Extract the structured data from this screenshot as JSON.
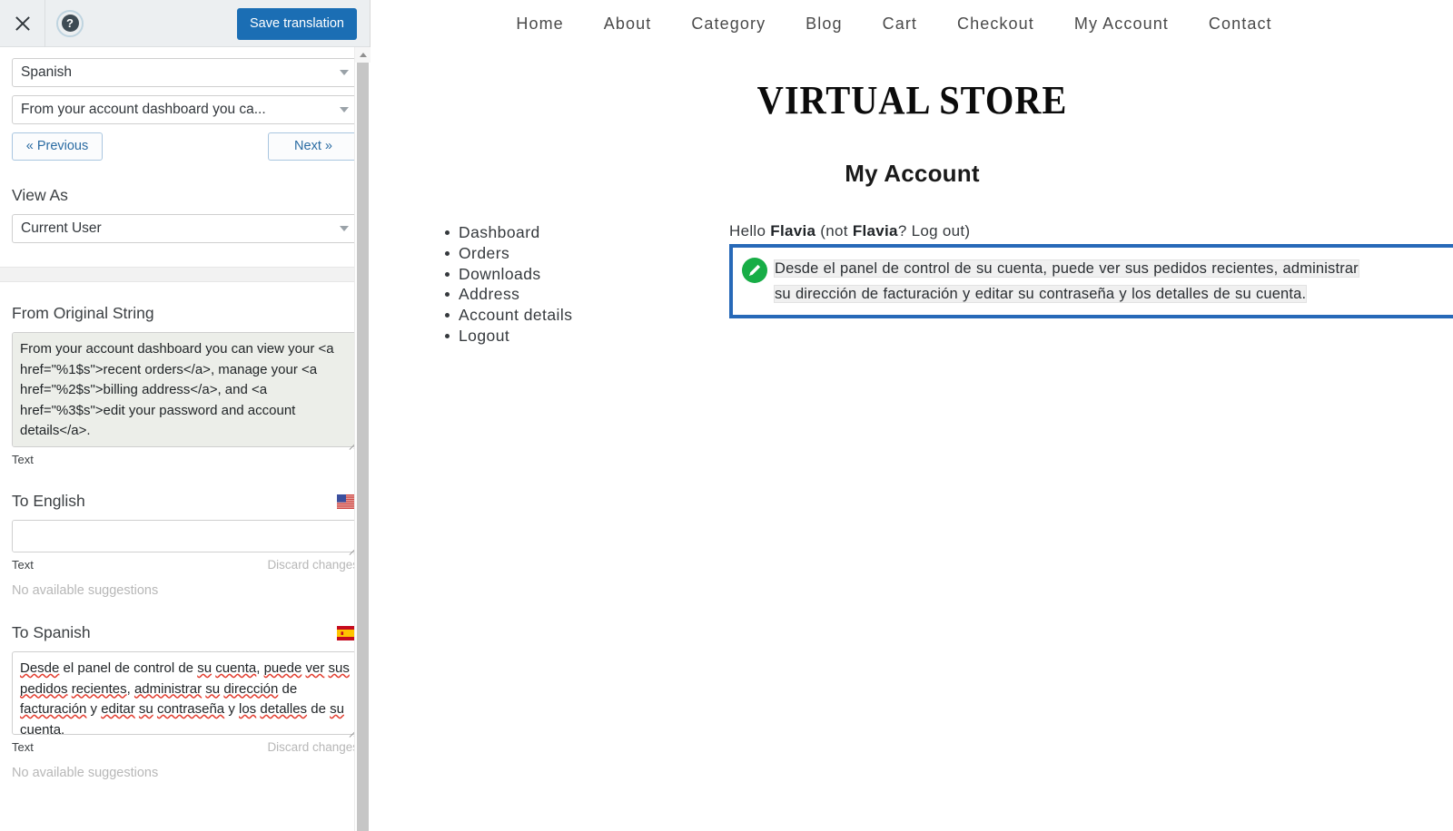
{
  "sidebar": {
    "header": {
      "close_icon": "close-icon",
      "help_icon": "help-icon",
      "help_glyph": "?",
      "save_label": "Save translation"
    },
    "language_select": {
      "value": "Spanish",
      "caret_icon": "chevron-down-icon"
    },
    "string_select": {
      "value": "From your account dashboard you ca...",
      "caret_icon": "chevron-down-icon"
    },
    "prev_label": "« Previous",
    "next_label": "Next »",
    "view_as": {
      "label": "View As",
      "value": "Current User",
      "caret_icon": "chevron-down-icon"
    },
    "original": {
      "label": "From Original String",
      "value": "From your account dashboard you can view your <a href=\"%1$s\">recent orders</a>, manage your <a href=\"%2$s\">billing address</a>, and <a href=\"%3$s\">edit your password and account details</a>.",
      "type_label": "Text"
    },
    "english": {
      "label": "To English",
      "flag": "us-flag-icon",
      "value": "",
      "placeholder": "",
      "type_label": "Text",
      "discard_label": "Discard changes",
      "suggestions": "No available suggestions"
    },
    "spanish": {
      "label": "To Spanish",
      "flag": "es-flag-icon",
      "value": "Desde el panel de control de su cuenta, puede ver sus pedidos recientes, administrar su dirección de facturación y editar su contraseña y los detalles de su cuenta.",
      "misspelled": [
        "Desde",
        "su",
        "cuenta",
        "puede",
        "ver",
        "sus",
        "pedidos",
        "recientes",
        "administrar",
        "su",
        "dirección",
        "facturación",
        "editar",
        "su",
        "contraseña",
        "los",
        "detalles",
        "su",
        "cuenta"
      ],
      "type_label": "Text",
      "discard_label": "Discard changes",
      "suggestions": "No available suggestions"
    },
    "scrollbar": {
      "up_arrow_icon": "scroll-up-arrow-icon"
    }
  },
  "main": {
    "topnav": [
      {
        "label": "Home"
      },
      {
        "label": "About"
      },
      {
        "label": "Category"
      },
      {
        "label": "Blog"
      },
      {
        "label": "Cart"
      },
      {
        "label": "Checkout"
      },
      {
        "label": "My Account"
      },
      {
        "label": "Contact"
      }
    ],
    "store_title": "VIRTUAL STORE",
    "page_heading": "My Account",
    "account_nav": [
      {
        "label": "Dashboard"
      },
      {
        "label": "Orders"
      },
      {
        "label": "Downloads"
      },
      {
        "label": "Address"
      },
      {
        "label": "Account details"
      },
      {
        "label": "Logout"
      }
    ],
    "hello": {
      "greeting": "Hello ",
      "username": "Flavia",
      "middle": " (not ",
      "username2": "Flavia",
      "logout_prefix": "? ",
      "logout_label": "Log out",
      "suffix": ")"
    },
    "highlighted": {
      "pencil_icon": "pencil-edit-icon",
      "text": "Desde el panel de control de su cuenta, puede ver sus pedidos recientes, administrar su dirección de facturación y editar su contraseña y los detalles de su cuenta."
    }
  },
  "colors": {
    "accent_blue": "#1b6eb4",
    "highlight_border": "#2769b8",
    "pencil_green": "#17ad46",
    "header_bg": "#eceff1",
    "original_textarea_bg": "#eceee9"
  }
}
